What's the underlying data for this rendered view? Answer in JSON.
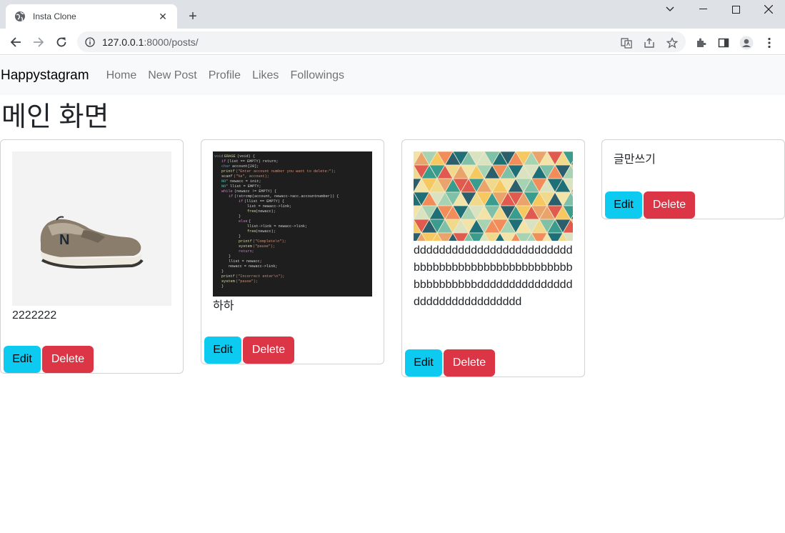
{
  "browser": {
    "tab_title": "Insta Clone",
    "url_host": "127.0.0.1",
    "url_rest": ":8000/posts/"
  },
  "navbar": {
    "brand": "Happystagram",
    "links": [
      "Home",
      "New Post",
      "Profile",
      "Likes",
      "Followings"
    ]
  },
  "page": {
    "title": "메인 화면"
  },
  "posts": [
    {
      "text": "2222222",
      "image": "sneaker-photo",
      "edit": "Edit",
      "delete": "Delete"
    },
    {
      "text": "하하",
      "image": "code-screenshot",
      "edit": "Edit",
      "delete": "Delete"
    },
    {
      "text": "dddddddddddddddddddddddddbbbbbbbbbbbbbbbbbbbbbbbbbbbbbbbbbbbdddddddddddddddddddddddddddddddd",
      "image": "triangle-pattern",
      "edit": "Edit",
      "delete": "Delete"
    },
    {
      "text": "글만쓰기",
      "image": null,
      "edit": "Edit",
      "delete": "Delete"
    }
  ],
  "colors": {
    "edit_button": "#0dcaf0",
    "delete_button": "#dc3545",
    "navbar_bg": "#f8f9fa"
  }
}
